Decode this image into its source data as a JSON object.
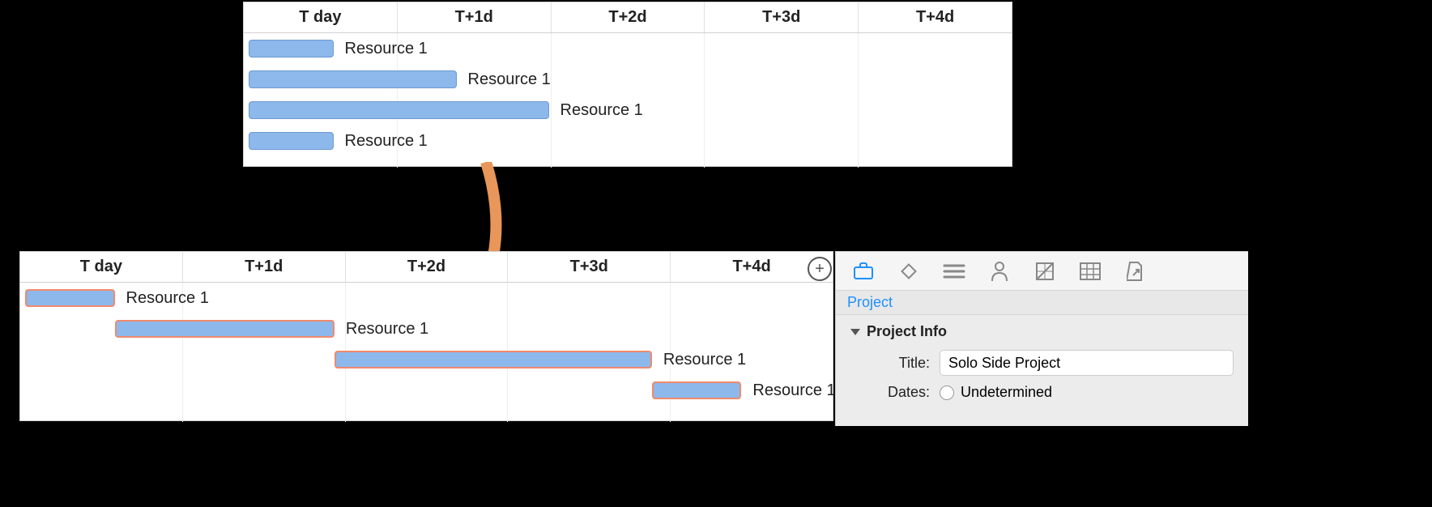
{
  "timeline": {
    "headers": [
      "T day",
      "T+1d",
      "T+2d",
      "T+3d",
      "T+4d"
    ]
  },
  "top_chart": {
    "rows": [
      {
        "label": "Resource 1",
        "start_col": 0,
        "width_cols": 0.55
      },
      {
        "label": "Resource 1",
        "start_col": 0,
        "width_cols": 1.35
      },
      {
        "label": "Resource 1",
        "start_col": 0,
        "width_cols": 1.95
      },
      {
        "label": "Resource 1",
        "start_col": 0,
        "width_cols": 0.55
      }
    ]
  },
  "bottom_chart": {
    "rows": [
      {
        "label": "Resource 1",
        "start_col": 0,
        "width_cols": 0.55,
        "selected": true
      },
      {
        "label": "Resource 1",
        "start_col": 0.55,
        "width_cols": 1.35,
        "selected": true
      },
      {
        "label": "Resource 1",
        "start_col": 1.9,
        "width_cols": 1.95,
        "selected": true
      },
      {
        "label": "Resource 1",
        "start_col": 3.85,
        "width_cols": 0.55,
        "selected": true
      }
    ]
  },
  "inspector": {
    "tab_label": "Project",
    "section_title": "Project Info",
    "title_label": "Title:",
    "title_value": "Solo Side Project",
    "dates_label": "Dates:",
    "dates_option1": "Undetermined",
    "icons": [
      "briefcase-icon",
      "diamond-icon",
      "stack-icon",
      "person-icon",
      "styles-icon",
      "table-icon",
      "export-icon"
    ]
  },
  "zoom_glyph": "+"
}
